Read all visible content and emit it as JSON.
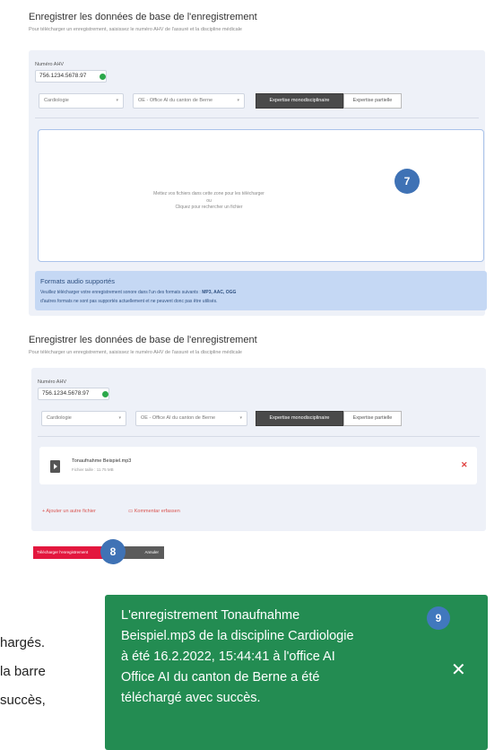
{
  "panel1": {
    "title": "Enregistrer les données de base de l'enregistrement",
    "subtitle": "Pour télécharger un enregistrement, saisissez le numéro AHV de l'assuré et la discipline médicale",
    "ahv_label": "Numéro AHV",
    "ahv_value": "756.1234.5678.97",
    "discipline_value": "Cardiologie",
    "office_value": "OE - Office AI du canton de Berne",
    "seg_mono": "Expertise monodisciplinaire",
    "seg_partial": "Expertise partielle",
    "dropzone_line1": "Mettez vos fichiers dans cette zone pour les télécharger",
    "dropzone_line2": "ou",
    "dropzone_line3": "Cliquez pour rechercher un fichier",
    "badge": "7",
    "formats_title": "Formats audio supportés",
    "formats_line1_prefix": "Veuillez télécharger votre enregistrement sonore dans l'un des formats suivants : ",
    "formats_line1_bold": "MP3, AAC, OGG",
    "formats_line2": "d'autres formats ne sont pas supportés actuellement et ne peuvent donc pas être utilisés."
  },
  "panel2": {
    "title": "Enregistrer les données de base de l'enregistrement",
    "subtitle": "Pour télécharger un enregistrement, saisissez le numéro AHV de l'assuré et la discipline médicale",
    "ahv_label": "Numéro AHV",
    "ahv_value": "756.1234.5678.97",
    "discipline_value": "Cardiologie",
    "office_value": "OE - Office AI du canton de Berne",
    "seg_mono": "Expertise monodisciplinaire",
    "seg_partial": "Expertise partielle",
    "file_name": "Tonaufnahme Beispiel.mp3",
    "file_size": "Fichier taille : 11.75 MB",
    "remove_icon": "✕",
    "add_file": "+ Ajouter un autre fichier",
    "add_comment": "Kommentar erfassen",
    "upload_button": "Télécharger l'enregistrement",
    "cancel_button": "Annuler",
    "badge": "8"
  },
  "fragments": {
    "line1": "hargés.",
    "line2": "la barre",
    "line3": "succès,"
  },
  "toast": {
    "line1": "L'enregistrement Tonaufnahme",
    "line2": "Beispiel.mp3 de la discipline Cardiologie",
    "line3": "à été 16.2.2022, 15:44:41 à l'office AI",
    "line4": "Office AI du canton de Berne a été",
    "line5": "téléchargé avec succès.",
    "close": "✕",
    "badge": "9"
  },
  "colors": {
    "toast_bg": "#238c52",
    "badge_blue": "#3f72b5",
    "primary_red": "#e3173e",
    "info_bg": "#c5d8f4"
  }
}
